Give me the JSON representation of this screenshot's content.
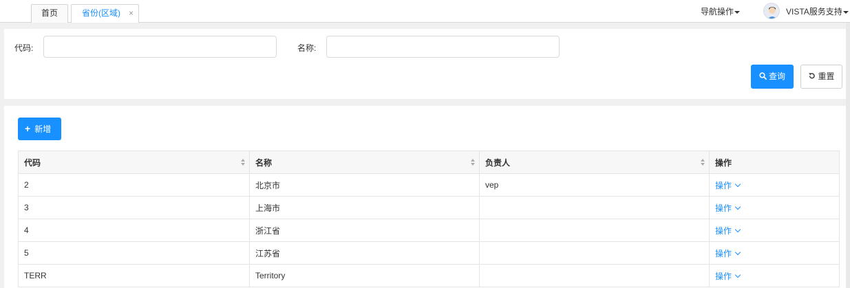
{
  "tabs": [
    {
      "label": "首页"
    },
    {
      "label": "省份(区域)",
      "close": "×"
    }
  ],
  "header": {
    "nav_label": "导航操作",
    "user_name": "VISTA服务支持"
  },
  "search": {
    "code_label": "代码:",
    "code_value": "",
    "name_label": "名称:",
    "name_value": "",
    "query_label": "查询",
    "reset_label": "重置"
  },
  "toolbar": {
    "add_label": "新增"
  },
  "table": {
    "columns": [
      "代码",
      "名称",
      "负责人",
      "操作"
    ],
    "rows": [
      {
        "code": "2",
        "name": "北京市",
        "owner": "vep",
        "action": "操作"
      },
      {
        "code": "3",
        "name": "上海市",
        "owner": "",
        "action": "操作"
      },
      {
        "code": "4",
        "name": "浙江省",
        "owner": "",
        "action": "操作"
      },
      {
        "code": "5",
        "name": "江苏省",
        "owner": "",
        "action": "操作"
      },
      {
        "code": "TERR",
        "name": "Territory",
        "owner": "",
        "action": "操作"
      }
    ]
  },
  "colors": {
    "primary": "#1890ff",
    "border": "#e4e4e4",
    "header_bg": "#f7f7f7"
  }
}
